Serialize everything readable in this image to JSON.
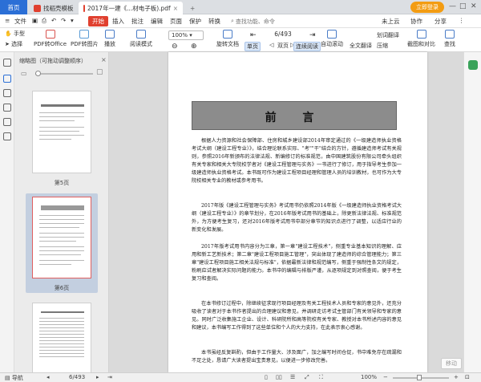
{
  "titlebar": {
    "home_tab": "首页",
    "tabs": [
      "找稻壳模板",
      "2017年一建《...材电子板).pdf"
    ],
    "login": "立即登录"
  },
  "menu": {
    "items": [
      "文件",
      "开始",
      "插入",
      "批注",
      "编辑",
      "页面",
      "保护",
      "转换"
    ],
    "search_placeholder": "查找功能、命令",
    "right": [
      "未上云",
      "协作",
      "分享"
    ]
  },
  "toolbar": {
    "hand": "手型",
    "select": "选择",
    "pdf_to_office": "PDF转Office",
    "pdf_to_image": "PDF转图片",
    "play": "播放",
    "read_mode": "阅读模式",
    "zoom": "100%",
    "rotate": "旋转文档",
    "page_display": "6/493",
    "single": "单页",
    "double": "双页",
    "continuous": "连续阅读",
    "auto_scroll": "自动滚动",
    "translate": "全文翻译",
    "zone_translate": "划词翻译",
    "compress": "压缩",
    "screenshot": "截图和对比",
    "find": "查找"
  },
  "thumbnails": {
    "title": "缩略图（可拖动调整顺序）",
    "labels": [
      "第5页",
      "第6页"
    ]
  },
  "document": {
    "heading": "前 言",
    "paragraphs": [
      "根据人力资源和社会保障部、住房和城乡建设部2014年审定通过的《一级建造师执业资格考试大纲（建设工程专业）》，结合理论联系实际、\"考\"\"干\"结合的方针，遵循建造师考试有关规则，参照2016年新颁布的法律法规、新编修订的标准规范，由中国建筑股份有限公司牵头组织有关专家和相关大专院校学者对《建设工程管理与实务》一书进行了修订，用于指导考生参加一级建造师执业资格考试。本书既可作为建设工程项目经理和管理人员的培训教材，也可作为大专院校相关专业的教材或参考用书。",
      "2017年版《建设工程管理与实务》考试用书仍依照2014年版《一级建造师执业资格考试大纲（建设工程专业）》的章节划分，在2016年版考试用书的基础上，除更新法律法规、标准规范外，为方便考生复习，还对2016年版考试用书中部分章节的知识点进行了调整，以适应行业的新变化和发展。",
      "2017年版考试用书内容分为三章，第一章\"建设工程技术\"，侧重专业基本知识的理解、应用和新工艺新技术；第二章\"建设工程项目施工管理\"，突出体现了建造师的综合管理能力；第三章\"建设工程项目施工相关法规与标准\"，依据最新法律和规范编写，侧重于强制性条文的规定，粉刷应试者解决实际问题的能力。本书中的编辑与排版严谨，从逐项规定到对照查阅，便于考生复习和查阅。",
      "在本书修订过程中，除继续征求现行项目经理及有关工程技术人员和专家的意见外，还充分吸收了读者对于本书作者提出的合理建议和意见，并调研走访考试主管部门有关领导和专家的意见。同时广泛收集施工企业、设计、科研院所和高等院校有关专家、教授对本书所述内容的意见和建议，本书编写工作得到了这些单位和个人的大力支持，在此表示衷心感谢。",
      "本书虽经反复斟酌，但由于工作量大、涉及面广，加之编写时间仓促，书中难免存在疏漏和不足之处，恳请广大读者提出宝贵意见，以便进一步修改完善。"
    ],
    "next_label": "移动"
  },
  "status": {
    "nav": "导航",
    "page": "6/493",
    "zoom": "100%"
  },
  "colors": {
    "accent": "#2b6fd6",
    "menu_active": "#e0402f",
    "login": "#f39c12"
  }
}
